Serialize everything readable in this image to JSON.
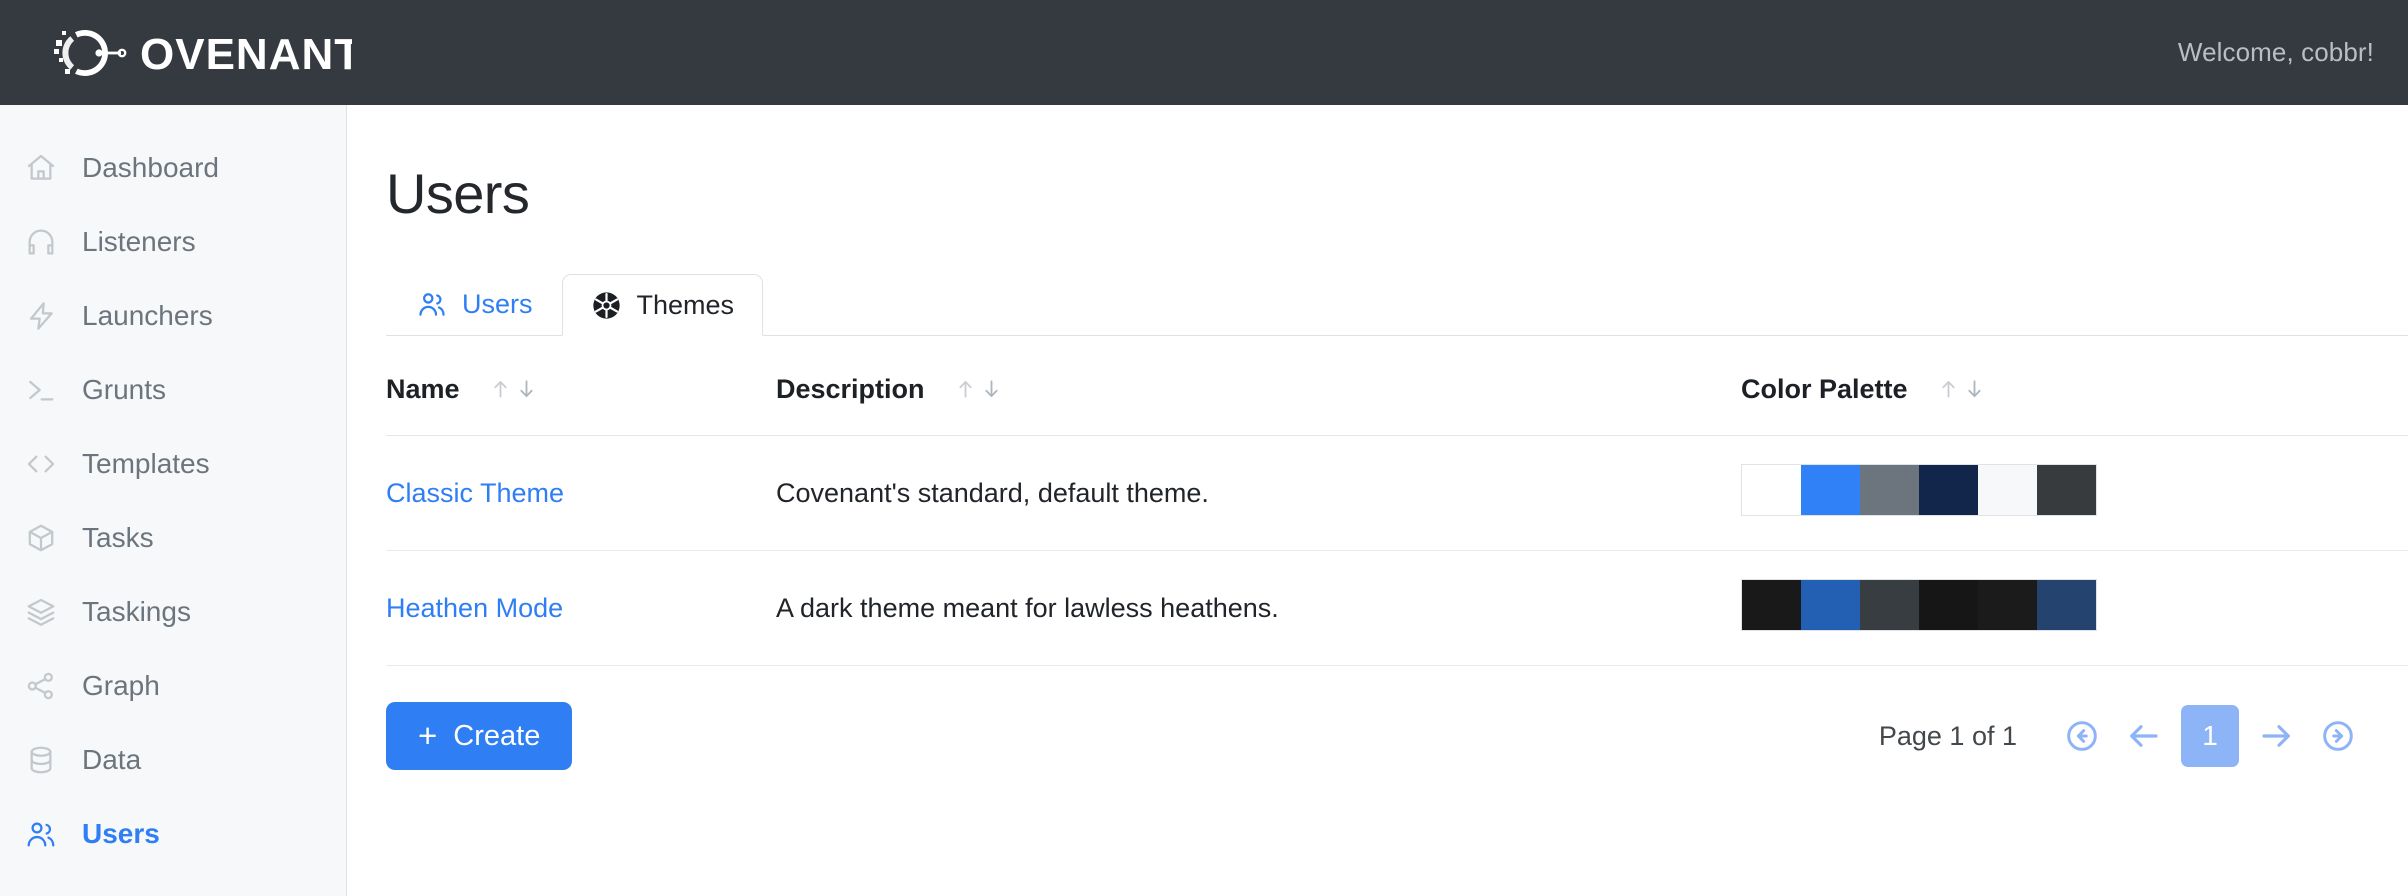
{
  "topbar": {
    "brand": "COVENANT",
    "welcome": "Welcome, cobbr!"
  },
  "sidebar": {
    "items": [
      {
        "label": "Dashboard",
        "icon": "home-icon",
        "active": false
      },
      {
        "label": "Listeners",
        "icon": "headphones-icon",
        "active": false
      },
      {
        "label": "Launchers",
        "icon": "bolt-icon",
        "active": false
      },
      {
        "label": "Grunts",
        "icon": "terminal-icon",
        "active": false
      },
      {
        "label": "Templates",
        "icon": "code-icon",
        "active": false
      },
      {
        "label": "Tasks",
        "icon": "box-icon",
        "active": false
      },
      {
        "label": "Taskings",
        "icon": "layers-icon",
        "active": false
      },
      {
        "label": "Graph",
        "icon": "share-icon",
        "active": false
      },
      {
        "label": "Data",
        "icon": "database-icon",
        "active": false
      },
      {
        "label": "Users",
        "icon": "users-icon",
        "active": true
      }
    ]
  },
  "main": {
    "page_title": "Users",
    "tabs": [
      {
        "label": "Users",
        "icon": "users-icon",
        "active": false
      },
      {
        "label": "Themes",
        "icon": "aperture-icon",
        "active": true
      }
    ],
    "table": {
      "headers": [
        "Name",
        "Description",
        "Color Palette"
      ],
      "rows": [
        {
          "name": "Classic Theme",
          "description": "Covenant's standard, default theme.",
          "palette": [
            "#ffffff",
            "#3080f8",
            "#6c757d",
            "#12254a",
            "#f6f8fa",
            "#373b3e"
          ]
        },
        {
          "name": "Heathen Mode",
          "description": "A dark theme meant for lawless heathens.",
          "palette": [
            "#191919",
            "#2360b4",
            "#383d41",
            "#161616",
            "#1b1b1b",
            "#24436f"
          ]
        }
      ]
    },
    "create_button": {
      "plus": "+",
      "label": "Create"
    },
    "pagination": {
      "label": "Page 1 of 1",
      "first_icon": "circle-arrow-left-icon",
      "prev_icon": "arrow-left-icon",
      "current_page": "1",
      "next_icon": "arrow-right-icon",
      "last_icon": "circle-arrow-right-icon"
    }
  },
  "colors": {
    "accent": "#2f7ef4",
    "topbar_bg": "#343a40",
    "sidebar_bg": "#f6f8fa",
    "pager_blue": "#8cb4f7"
  }
}
